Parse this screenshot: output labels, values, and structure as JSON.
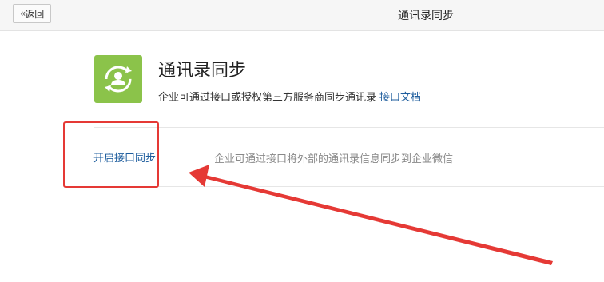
{
  "header": {
    "back_label": "返回",
    "title": "通讯录同步"
  },
  "app": {
    "title": "通讯录同步",
    "description": "企业可通过接口或授权第三方服务商同步通讯录",
    "doc_link": "接口文档",
    "icon": "contacts-sync-icon",
    "icon_color": "#8bc34a"
  },
  "sync": {
    "enable_label": "开启接口同步",
    "description": "企业可通过接口将外部的通讯录信息同步到企业微信"
  },
  "annotation": {
    "color": "#e53935"
  }
}
